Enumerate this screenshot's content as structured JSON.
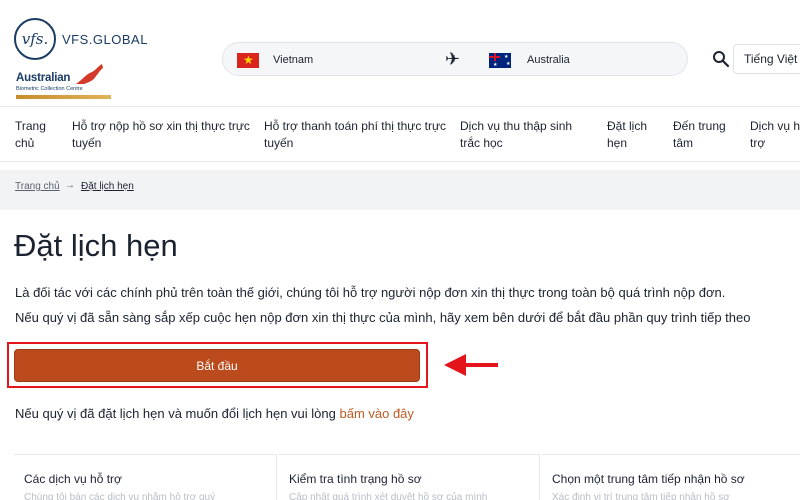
{
  "header": {
    "logo_mark": "vfs.",
    "logo_text": "VFS.GLOBAL",
    "abcc_title": "Australian",
    "abcc_sub": "Biometric Collection Centre",
    "route_from": "Vietnam",
    "route_to": "Australia",
    "language": "Tiếng Việt"
  },
  "nav": {
    "items": [
      "Trang chủ",
      "Hỗ trợ nộp hồ sơ xin thị thực trực tuyến",
      "Hỗ trợ thanh toán phí thị thực trực tuyến",
      "Dịch vụ thu thập sinh trắc học",
      "Đặt lịch hẹn",
      "Đến trung tâm",
      "Dịch vụ hỗ trợ"
    ]
  },
  "breadcrumb": {
    "home": "Trang chủ",
    "arrow": "→",
    "current": "Đặt lịch hẹn"
  },
  "main": {
    "title": "Đặt lịch hẹn",
    "intro_line1": "Là đối tác với các chính phủ trên toàn thế giới, chúng tôi hỗ trợ người nộp đơn xin thị thực trong toàn bộ quá trình nộp đơn.",
    "intro_line2": "Nếu quý vị đã sẵn sàng sắp xếp cuộc hẹn nộp đơn xin thị thực của mình, hãy xem bên dưới để bắt đầu phần quy trình tiếp theo",
    "start_button": "Bắt đầu",
    "reschedule_text": "Nếu quý vị đã đặt lịch hẹn và muốn đổi lịch hẹn vui lòng ",
    "reschedule_link": "bấm vào đây"
  },
  "cards": [
    {
      "title": "Các dịch vụ hỗ trợ",
      "desc": "Chúng tôi bán các dịch vụ nhằm hỗ trợ quý"
    },
    {
      "title": "Kiểm tra tình trạng hồ sơ",
      "desc": "Cập nhật quá trình xét duyệt hồ sơ của mình"
    },
    {
      "title": "Chọn một trung tâm tiếp nhận hồ sơ",
      "desc": "Xác định vị trí trung tâm tiếp nhận hồ sơ"
    }
  ],
  "colors": {
    "brand_navy": "#1a3c64",
    "button_bg": "#bb4a1d",
    "link": "#c05a23",
    "annotation_red": "#e3141b"
  },
  "icons": [
    "search-icon",
    "plane-icon",
    "vietnam-flag-icon",
    "australia-flag-icon",
    "kangaroo-icon",
    "arrow-left-icon"
  ]
}
